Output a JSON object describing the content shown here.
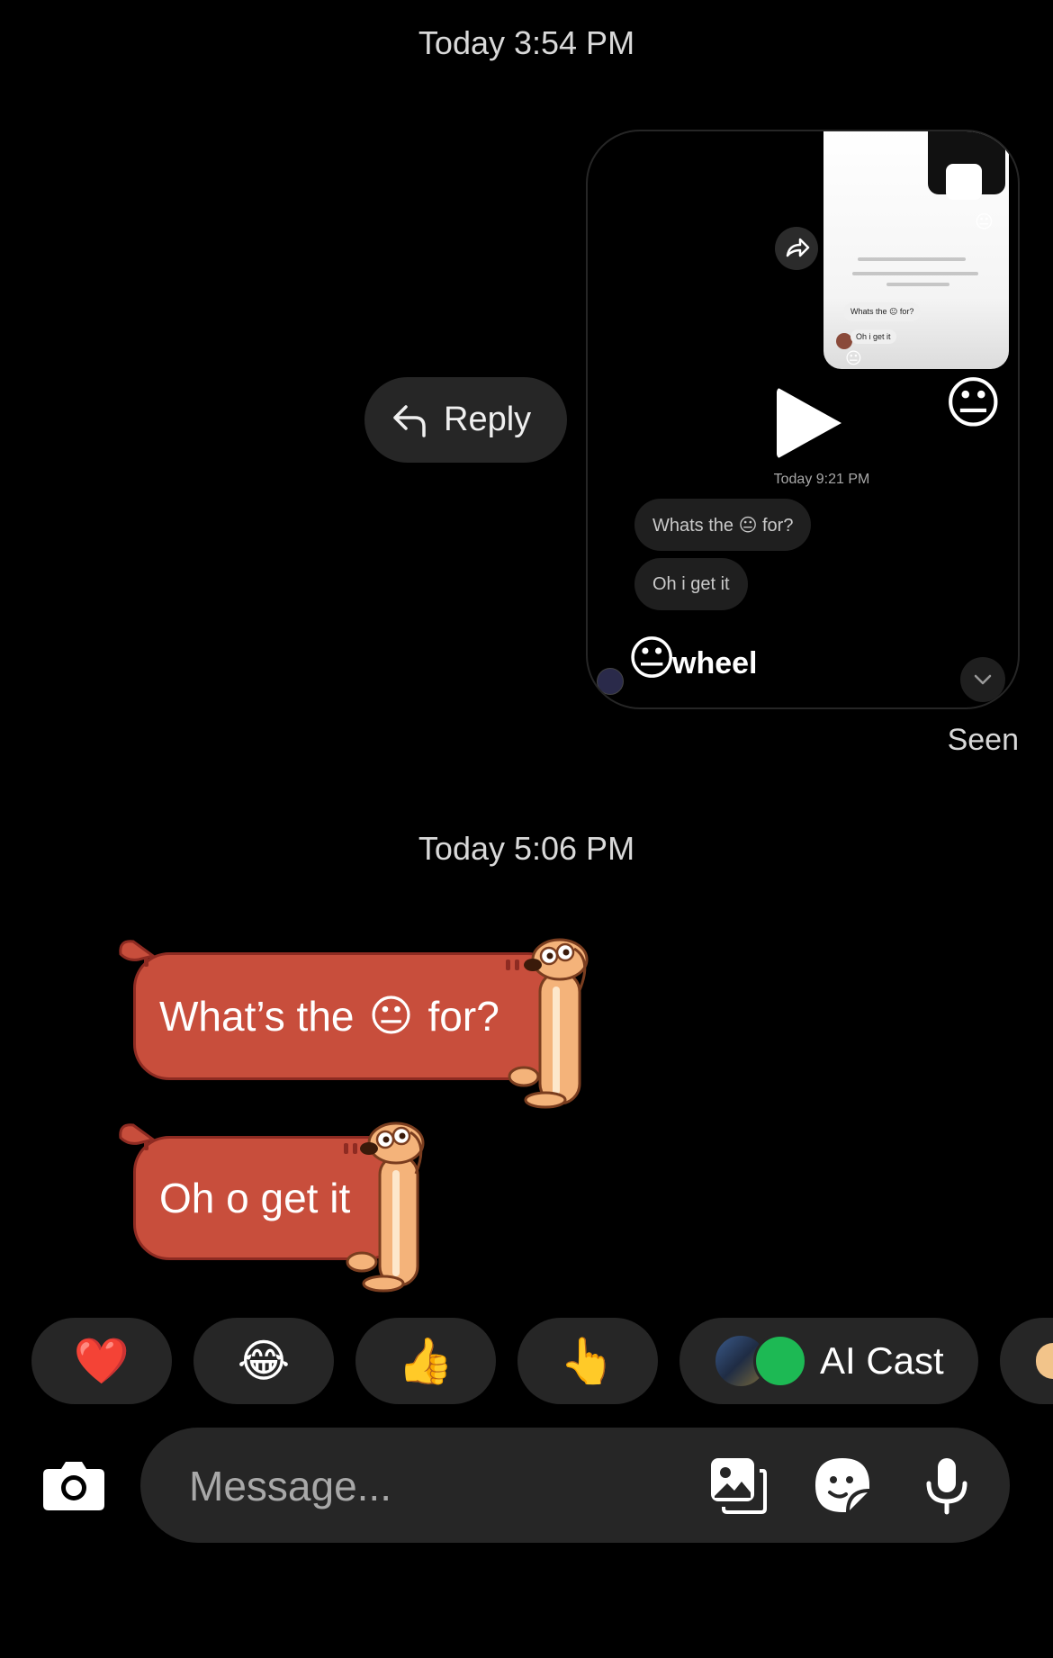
{
  "thread": {
    "timestamp_1": "Today 3:54 PM",
    "timestamp_2": "Today 5:06 PM",
    "seen_label": "Seen"
  },
  "reply_pill": {
    "label": "Reply"
  },
  "shared_card": {
    "mini_bubble_1": "Whats the 😐 for?",
    "mini_bubble_2": "Oh i get it",
    "neutral_emoji": "😐",
    "time": "Today 9:21 PM",
    "bubble_1": "Whats the 😐 for?",
    "bubble_2": "Oh i get it",
    "sticker_emoji": "😐",
    "sticker_word": "wheel"
  },
  "messages": [
    {
      "text_before": "What’s the",
      "emoji": "😐",
      "text_after": "for?"
    },
    {
      "text": "Oh o get it"
    }
  ],
  "reactions": [
    {
      "emoji": "❤️",
      "icon": "heart-icon"
    },
    {
      "emoji": "😂",
      "icon": "tears-of-joy-icon"
    },
    {
      "emoji": "👍",
      "icon": "thumbs-up-icon"
    },
    {
      "emoji": "👆",
      "icon": "pointing-up-icon"
    }
  ],
  "ai_cast": {
    "label": "AI Cast"
  },
  "composer": {
    "placeholder": "Message...",
    "icons": [
      "camera-icon",
      "gallery-icon",
      "sticker-icon",
      "microphone-icon"
    ]
  },
  "colors": {
    "background": "#000000",
    "pill": "#262626",
    "theme_bubble": "#c84e3c",
    "theme_dog": "#f4b37a"
  }
}
